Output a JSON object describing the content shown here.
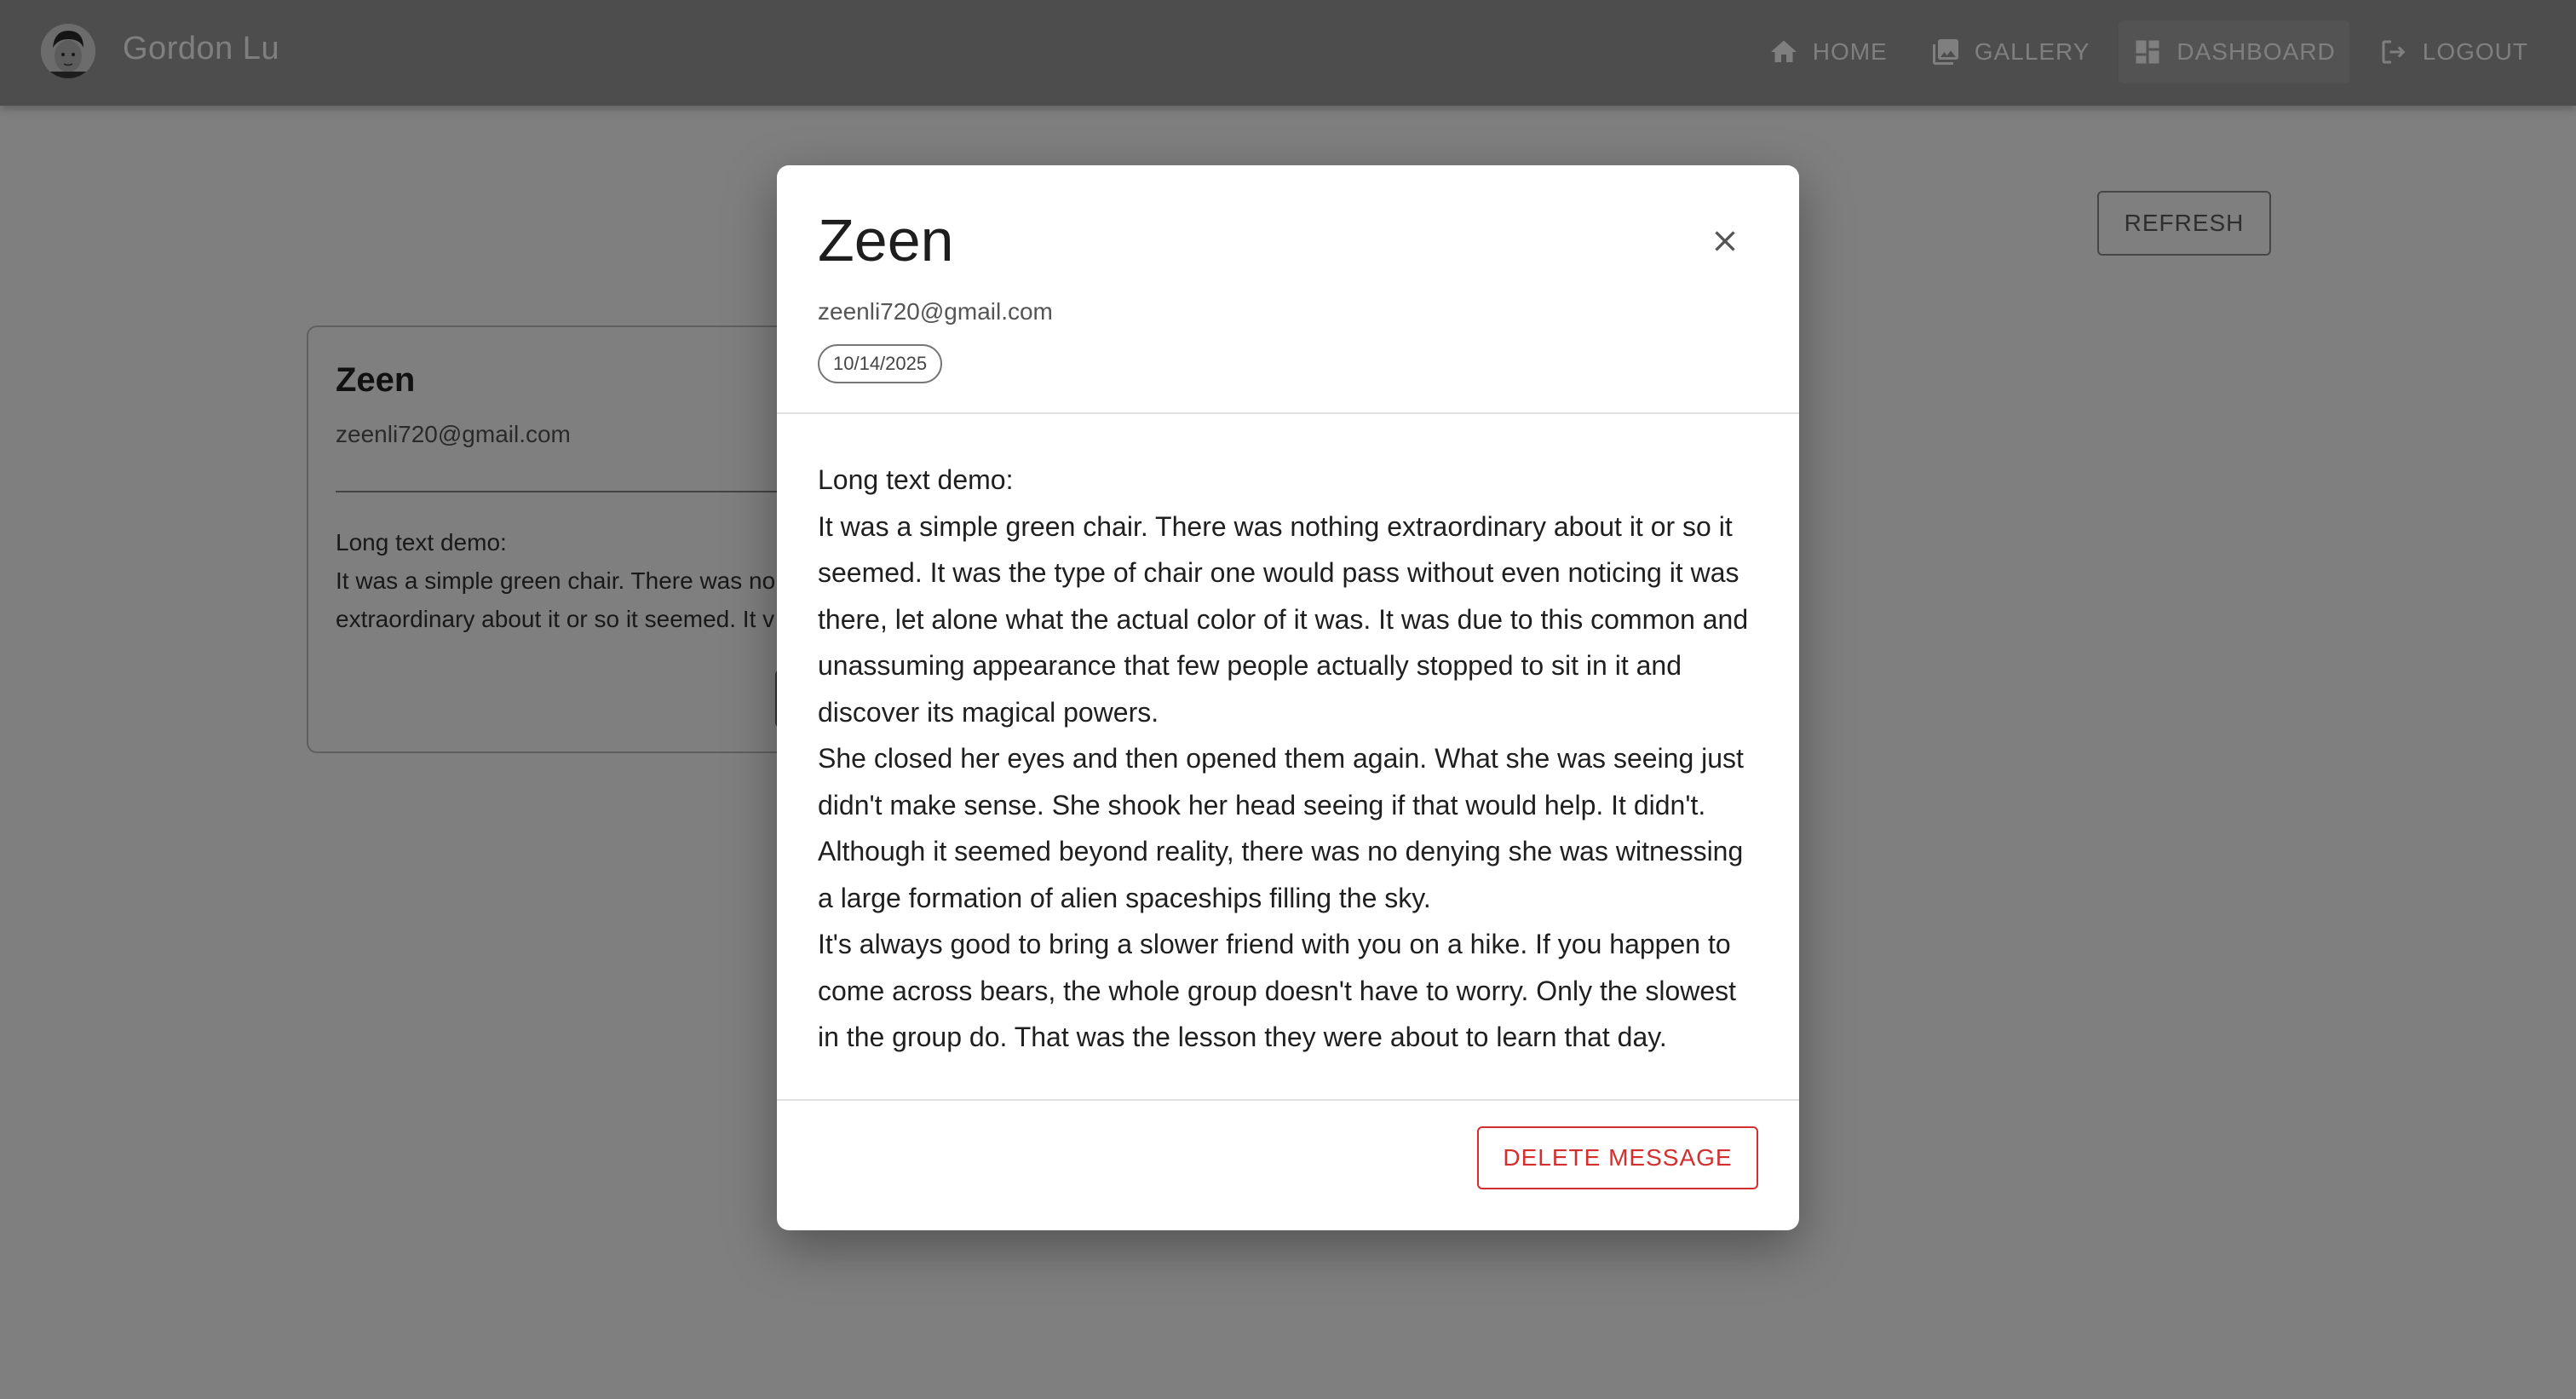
{
  "header": {
    "brand": "Gordon Lu",
    "nav": [
      {
        "label": "HOME",
        "icon": "home-icon"
      },
      {
        "label": "GALLERY",
        "icon": "gallery-icon"
      },
      {
        "label": "DASHBOARD",
        "icon": "dashboard-icon",
        "active": true
      },
      {
        "label": "LOGOUT",
        "icon": "logout-icon"
      }
    ]
  },
  "toolbar": {
    "refresh_label": "REFRESH"
  },
  "card": {
    "name": "Zeen",
    "email": "zeenli720@gmail.com",
    "preview": "Long text demo:\nIt was a simple green chair. There was no\nextraordinary about it or so it seemed. It v\ntype of chair one would pass without eve"
  },
  "dialog": {
    "name": "Zeen",
    "email": "zeenli720@gmail.com",
    "date": "10/14/2025",
    "body": "Long text demo:\nIt was a simple green chair. There was nothing extraordinary about it or so it seemed. It was the type of chair one would pass without even noticing it was there, let alone what the actual color of it was. It was due to this common and unassuming appearance that few people actually stopped to sit in it and discover its magical powers.\nShe closed her eyes and then opened them again. What she was seeing just didn't make sense. She shook her head seeing if that would help. It didn't. Although it seemed beyond reality, there was no denying she was witnessing a large formation of alien spaceships filling the sky.\nIt's always good to bring a slower friend with you on a hike. If you happen to come across bears, the whole group doesn't have to worry. Only the slowest in the group do. That was the lesson they were about to learn that day.",
    "delete_label": "DELETE MESSAGE"
  },
  "colors": {
    "delete": "#d32f2f",
    "backdrop": "rgba(0,0,0,0.5)"
  }
}
